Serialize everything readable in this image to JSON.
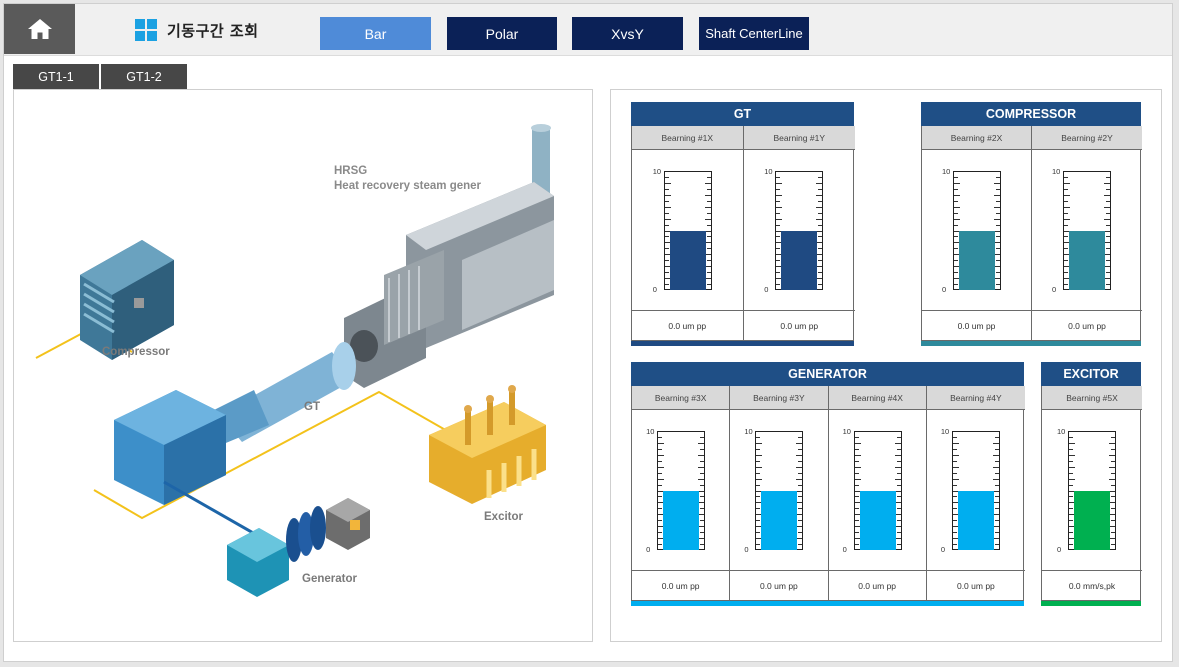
{
  "header": {
    "title": "기동구간 조회",
    "nav": [
      {
        "label": "Bar",
        "active": true
      },
      {
        "label": "Polar",
        "active": false
      },
      {
        "label": "XvsY",
        "active": false
      },
      {
        "label": "Shaft CenterLine",
        "active": false
      }
    ]
  },
  "tabs": [
    "GT1-1",
    "GT1-2"
  ],
  "diagram": {
    "hrsg_line1": "HRSG",
    "hrsg_line2": "Heat recovery steam gener",
    "compressor": "Compressor",
    "gt": "GT",
    "excitor": "Excitor",
    "generator": "Generator"
  },
  "colors": {
    "nav_dark": "#0b2157",
    "nav_active": "#4f8bd8",
    "group_header": "#1f4f86",
    "gt_fill": "#1f4a82",
    "compressor_fill": "#2e8a9c",
    "generator_fill": "#00aeef",
    "excitor_fill": "#00b050"
  },
  "groups": {
    "gt": {
      "title": "GT",
      "bottom_color": "#1f4a82",
      "fill_color": "#1f4a82",
      "bearings": [
        {
          "label": "Bearning #1X",
          "value": "0.0 um pp",
          "level": 0.5
        },
        {
          "label": "Bearning #1Y",
          "value": "0.0 um pp",
          "level": 0.5
        }
      ]
    },
    "compressor": {
      "title": "COMPRESSOR",
      "bottom_color": "#2e8a9c",
      "fill_color": "#2e8a9c",
      "bearings": [
        {
          "label": "Bearning #2X",
          "value": "0.0 um pp",
          "level": 0.5
        },
        {
          "label": "Bearning #2Y",
          "value": "0.0 um pp",
          "level": 0.5
        }
      ]
    },
    "generator": {
      "title": "GENERATOR",
      "bottom_color": "#00aeef",
      "fill_color": "#00aeef",
      "bearings": [
        {
          "label": "Bearning #3X",
          "value": "0.0 um pp",
          "level": 0.5
        },
        {
          "label": "Bearning #3Y",
          "value": "0.0 um pp",
          "level": 0.5
        },
        {
          "label": "Bearning #4X",
          "value": "0.0 um pp",
          "level": 0.5
        },
        {
          "label": "Bearning #4Y",
          "value": "0.0 um pp",
          "level": 0.5
        }
      ]
    },
    "excitor": {
      "title": "EXCITOR",
      "bottom_color": "#00b050",
      "fill_color": "#00b050",
      "bearings": [
        {
          "label": "Bearning #5X",
          "value": "0.0 mm/s,pk",
          "level": 0.5
        }
      ]
    }
  },
  "gauge_scale": {
    "max": "10",
    "min": "0"
  }
}
